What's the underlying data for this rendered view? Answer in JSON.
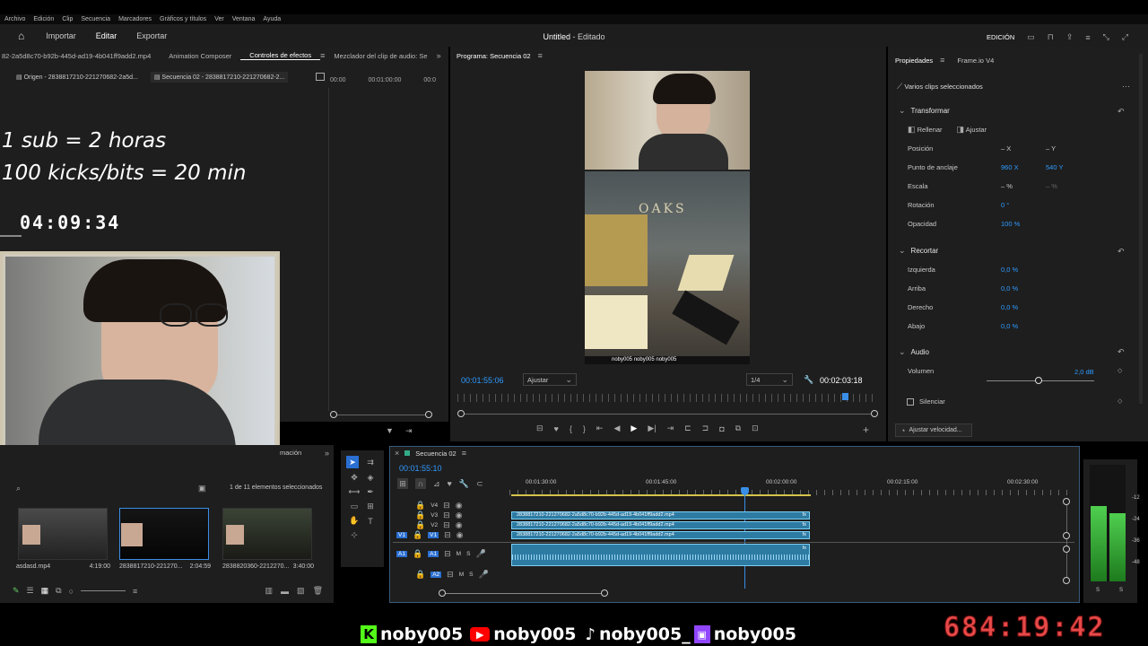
{
  "menu": [
    "Archivo",
    "Edición",
    "Clip",
    "Secuencia",
    "Marcadores",
    "Gráficos y títulos",
    "Ver",
    "Ventana",
    "Ayuda"
  ],
  "nav": {
    "import": "Importar",
    "edit": "Editar",
    "export": "Exportar"
  },
  "title": {
    "name": "Untitled",
    "suffix": " - Editado"
  },
  "workspace": "EDICIÓN",
  "left_tabs": {
    "file": "82-2a5d8c70-b92b-445d-ad19-4b041ff9add2.mp4",
    "composer": "Animation Composer",
    "effects": "Controles de efectos",
    "mixer": "Mezclador del clip de audio: Se"
  },
  "source_tabs": {
    "origin": "Origen - 2838817210-221270682-2a5d...",
    "seq": "Secuencia 02 - 2838817210-221270682-2..."
  },
  "source_ruler": [
    "00:00",
    "00:01:00:00",
    "00:0"
  ],
  "overlay": {
    "line1": "1 sub = 2 horas",
    "line2": "100 kicks/bits = 20 min",
    "timer": "04:09:34",
    "big_timer": "684:19:42"
  },
  "program": {
    "tab": "Programa: Secuencia 02",
    "timecode": "00:01:55:06",
    "fit": "Ajustar",
    "quality": "1/4",
    "duration": "00:02:03:18",
    "sign": "OAKS",
    "strip": "noby005 noby005 noby005"
  },
  "props": {
    "tab": "Propiedades",
    "frame": "Frame.io V4",
    "selected": "Varios clips seleccionados",
    "transform": "Transformar",
    "fill": "Rellenar",
    "fit": "Ajustar",
    "rows": [
      {
        "label": "Posición",
        "v1": "– X",
        "v2": "– Y"
      },
      {
        "label": "Punto de anclaje",
        "v1": "960 X",
        "v2": "540 Y"
      },
      {
        "label": "Escala",
        "v1": "– %",
        "v2": "– %"
      },
      {
        "label": "Rotación",
        "v1": "0 °",
        "v2": ""
      },
      {
        "label": "Opacidad",
        "v1": "100 %",
        "v2": ""
      }
    ],
    "crop": "Recortar",
    "crop_rows": [
      {
        "label": "Izquierda",
        "v": "0,0 %"
      },
      {
        "label": "Arriba",
        "v": "0,0 %"
      },
      {
        "label": "Derecho",
        "v": "0,0 %"
      },
      {
        "label": "Abajo",
        "v": "0,0 %"
      }
    ],
    "audio": "Audio",
    "volume": "Volumen",
    "volume_value": "2,0 dB",
    "mute": "Silenciar",
    "speed": "Ajustar velocidad..."
  },
  "project": {
    "tab_suffix": "mación",
    "count": "1 de 11 elementos seleccionados",
    "items": [
      {
        "name": "asdasd.mp4",
        "dur": "4:19:00"
      },
      {
        "name": "2838817210-221270...",
        "dur": "2:04:59"
      },
      {
        "name": "2838820360-2212270...",
        "dur": "3:40:00"
      }
    ]
  },
  "timeline": {
    "tab": "Secuencia 02",
    "timecode": "00:01:55:10",
    "ruler": [
      "00:01:30:00",
      "00:01:45:00",
      "00:02:00:00",
      "00:02:15:00",
      "00:02:30:00"
    ],
    "tracks": [
      "V4",
      "V3",
      "V2",
      "V1",
      "A1",
      "A2"
    ],
    "clip_name": "2838817210-221270682-2a5d8c70-b92b-445d-ad19-4b041ff9add2.mp4",
    "fx": "fx"
  },
  "meters": [
    "-12",
    "-24",
    "-36",
    "-48",
    "S",
    "S"
  ],
  "socials": [
    "noby005",
    "noby005",
    "noby005_",
    "noby005"
  ]
}
